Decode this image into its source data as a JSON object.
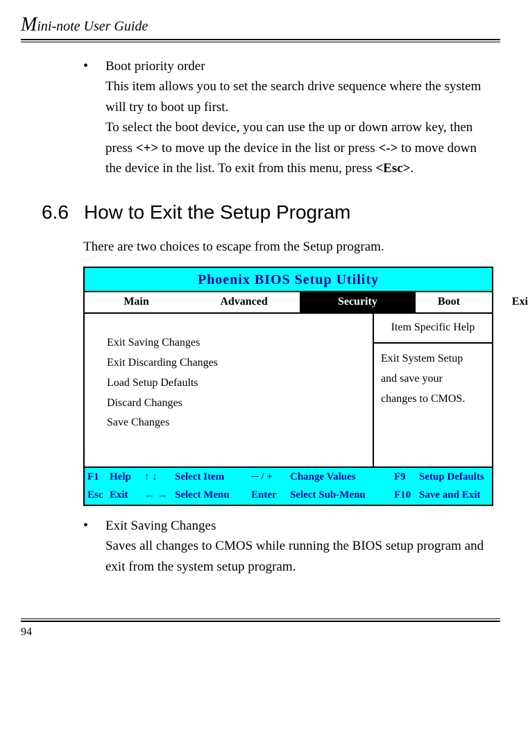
{
  "header": "ini-note User Guide",
  "header_big": "M",
  "bullet1": {
    "title": "Boot priority order",
    "p1": "This item allows you to set the search drive sequence where the system will try to boot up first.",
    "p2a": "To select the boot device, you can use the up or down arrow key, then press ",
    "p2_k1": "<+>",
    "p2b": " to move up the device in the list or press ",
    "p2_k2": "<->",
    "p2c": " to move down the device in the list. To exit from this menu, press ",
    "p2_k3": "<Esc>",
    "p2d": "."
  },
  "section": {
    "num": "6.6",
    "title": "How to Exit the Setup Program"
  },
  "intro": "There are two choices to escape from the Setup program.",
  "bios": {
    "title": "Phoenix BIOS Setup Utility",
    "tabs": {
      "main": "Main",
      "advanced": "Advanced",
      "security": "Security",
      "boot": "Boot",
      "exit": "Exit"
    },
    "items": [
      "Exit Saving Changes",
      "Exit Discarding Changes",
      "Load Setup Defaults",
      "Discard Changes",
      "Save Changes"
    ],
    "help_head": "Item Specific Help",
    "help_body1": "Exit System Setup",
    "help_body2": "and save your",
    "help_body3": "changes to CMOS.",
    "footer": {
      "r1": {
        "c1": "F1",
        "c2": "Help",
        "c3": "↑ ↓",
        "c4": "Select Item",
        "c5": "─ / +",
        "c6": "Change Values",
        "c7": "F9",
        "c8": "Setup Defaults"
      },
      "r2": {
        "c1": "Esc",
        "c2": "Exit",
        "c3": "← →",
        "c4": "Select Menu",
        "c5": "Enter",
        "c6": "Select Sub-Menu",
        "c7": "F10",
        "c8": "Save and Exit"
      }
    }
  },
  "bullet2": {
    "title": "Exit Saving Changes",
    "body": "Saves all changes to CMOS while running the BIOS setup program and exit from the system setup program."
  },
  "pagenum": "94"
}
